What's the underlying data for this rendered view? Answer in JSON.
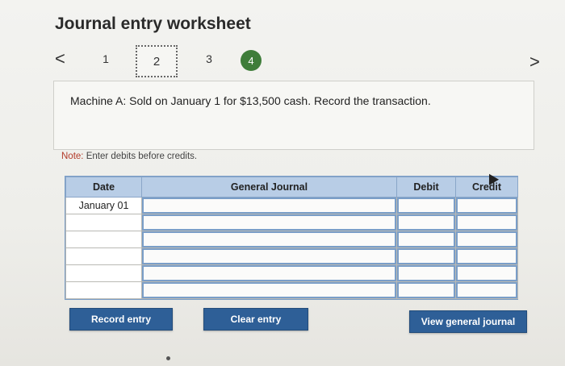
{
  "header": {
    "title": "Journal entry worksheet"
  },
  "stepper": {
    "prev": "<",
    "next": ">",
    "steps": [
      "1",
      "2",
      "3",
      "4"
    ]
  },
  "question": {
    "text": "Machine A: Sold on January 1 for $13,500 cash. Record the transaction."
  },
  "note": {
    "label": "Note:",
    "text": " Enter debits before credits."
  },
  "grid": {
    "headers": {
      "date": "Date",
      "journal": "General Journal",
      "debit": "Debit",
      "credit": "Credit"
    },
    "rows": [
      {
        "date": "January 01"
      },
      {
        "date": ""
      },
      {
        "date": ""
      },
      {
        "date": ""
      },
      {
        "date": ""
      },
      {
        "date": ""
      }
    ]
  },
  "buttons": {
    "record": "Record entry",
    "clear": "Clear entry",
    "view": "View general journal"
  },
  "colors": {
    "accent": "#2e5f97",
    "done_step": "#3f7d3a",
    "note": "#b33b2a"
  }
}
